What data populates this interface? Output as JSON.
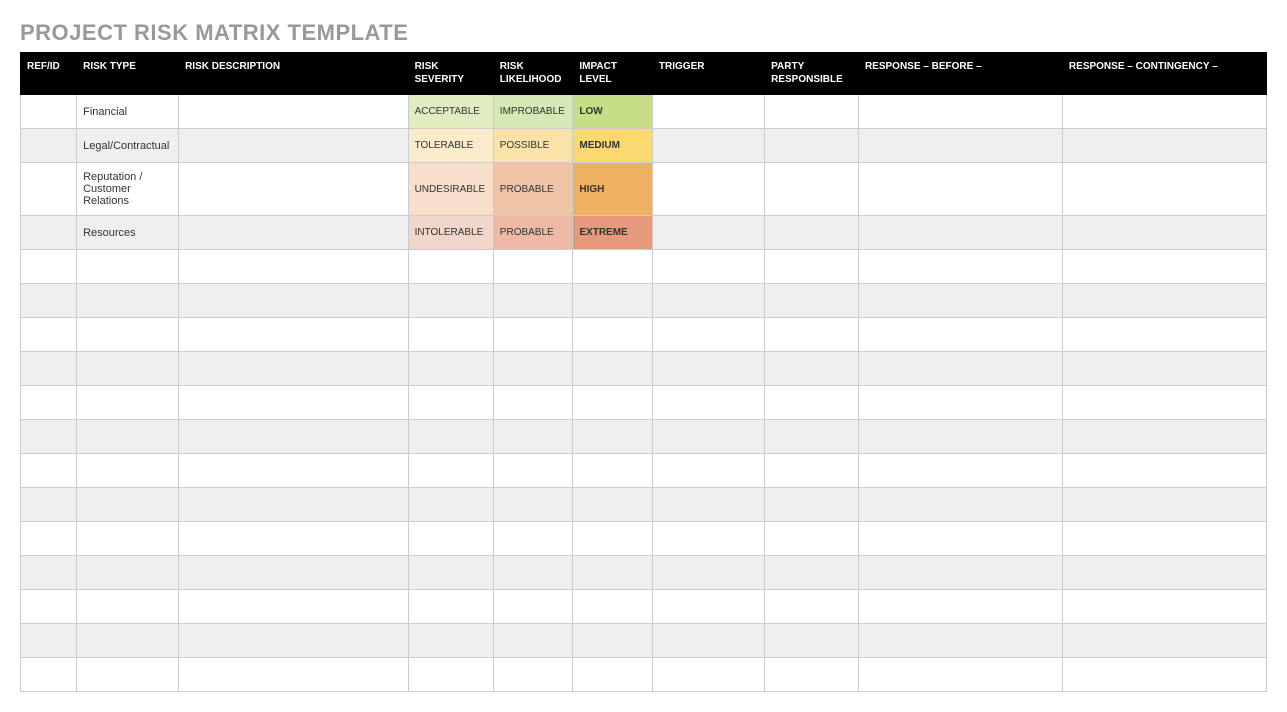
{
  "title": "PROJECT RISK MATRIX TEMPLATE",
  "headers": {
    "refid": "REF/ID",
    "risk_type": "RISK TYPE",
    "risk_description": "RISK DESCRIPTION",
    "risk_severity": "RISK SEVERITY",
    "risk_likelihood": "RISK LIKELIHOOD",
    "impact_level": "IMPACT LEVEL",
    "trigger": "TRIGGER",
    "party_responsible": "PARTY RESPONSIBLE",
    "response_before": "RESPONSE – BEFORE –",
    "response_contingency": "RESPONSE – CONTINGENCY –"
  },
  "rows": [
    {
      "refid": "",
      "risk_type": "Financial",
      "risk_description": "",
      "risk_severity": "ACCEPTABLE",
      "risk_likelihood": "IMPROBABLE",
      "impact_level": "LOW",
      "trigger": "",
      "party_responsible": "",
      "response_before": "",
      "response_contingency": "",
      "sev_color": "#e1edc0",
      "like_color": "#d6e8b4",
      "impact_color": "#c6de87"
    },
    {
      "refid": "",
      "risk_type": "Legal/Contractual",
      "risk_description": "",
      "risk_severity": "TOLERABLE",
      "risk_likelihood": "POSSIBLE",
      "impact_level": "MEDIUM",
      "trigger": "",
      "party_responsible": "",
      "response_before": "",
      "response_contingency": "",
      "sev_color": "#faeccb",
      "like_color": "#fae2a8",
      "impact_color": "#fbd96e"
    },
    {
      "refid": "",
      "risk_type": "Reputation / Customer Relations",
      "risk_description": "",
      "risk_severity": "UNDESIRABLE",
      "risk_likelihood": "PROBABLE",
      "impact_level": "HIGH",
      "trigger": "",
      "party_responsible": "",
      "response_before": "",
      "response_contingency": "",
      "sev_color": "#f7e0cb",
      "like_color": "#f0c4a6",
      "impact_color": "#eeb164"
    },
    {
      "refid": "",
      "risk_type": "Resources",
      "risk_description": "",
      "risk_severity": "INTOLERABLE",
      "risk_likelihood": "PROBABLE",
      "impact_level": "EXTREME",
      "trigger": "",
      "party_responsible": "",
      "response_before": "",
      "response_contingency": "",
      "sev_color": "#f3d6cb",
      "like_color": "#eeb9a5",
      "impact_color": "#e69a7c"
    }
  ],
  "empty_row_count": 13
}
